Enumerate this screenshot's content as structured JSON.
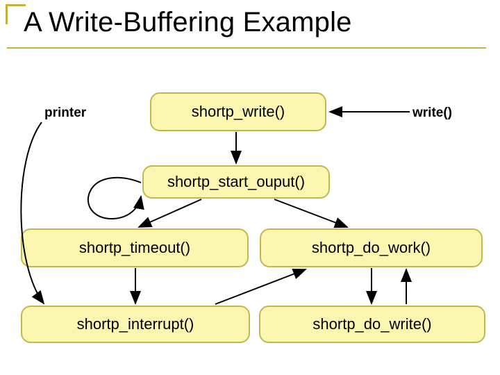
{
  "title": "A Write-Buffering Example",
  "labels": {
    "printer": "printer",
    "write_call": "write()"
  },
  "nodes": {
    "shortp_write": "shortp_write()",
    "shortp_start_ouput": "shortp_start_ouput()",
    "shortp_timeout": "shortp_timeout()",
    "shortp_do_work": "shortp_do_work()",
    "shortp_interrupt": "shortp_interrupt()",
    "shortp_do_write": "shortp_do_write()"
  }
}
